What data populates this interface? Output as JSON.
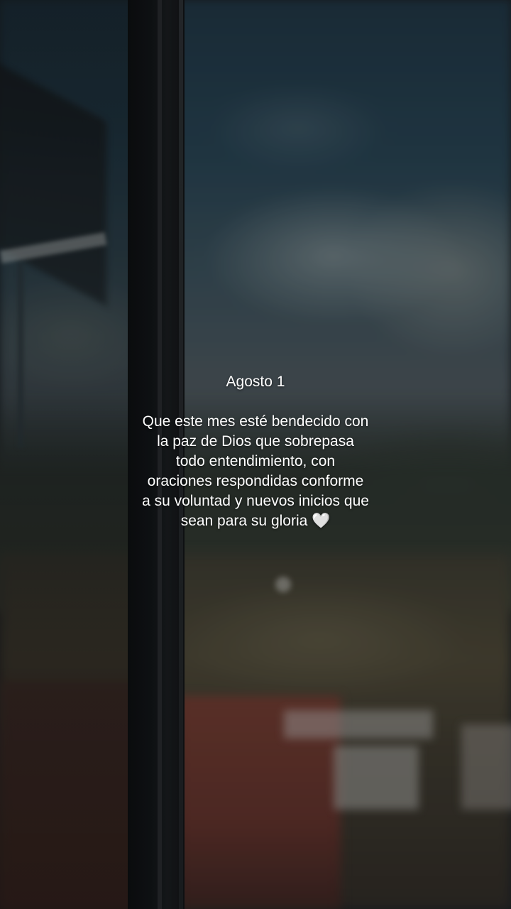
{
  "caption": {
    "date": "Agosto 1",
    "body": "Que este mes esté bendecido con\nla paz de Dios que sobrepasa\ntodo entendimiento, con\noraciones respondidas conforme\na su voluntad y nuevos inicios que\nsean para su gloria 🤍"
  },
  "scene": {
    "colors": {
      "sky": "#26404f",
      "clouds": "#969fa0",
      "ground": "#4a4535",
      "roof_red": "#6c3a30",
      "frame": "#111417"
    }
  }
}
